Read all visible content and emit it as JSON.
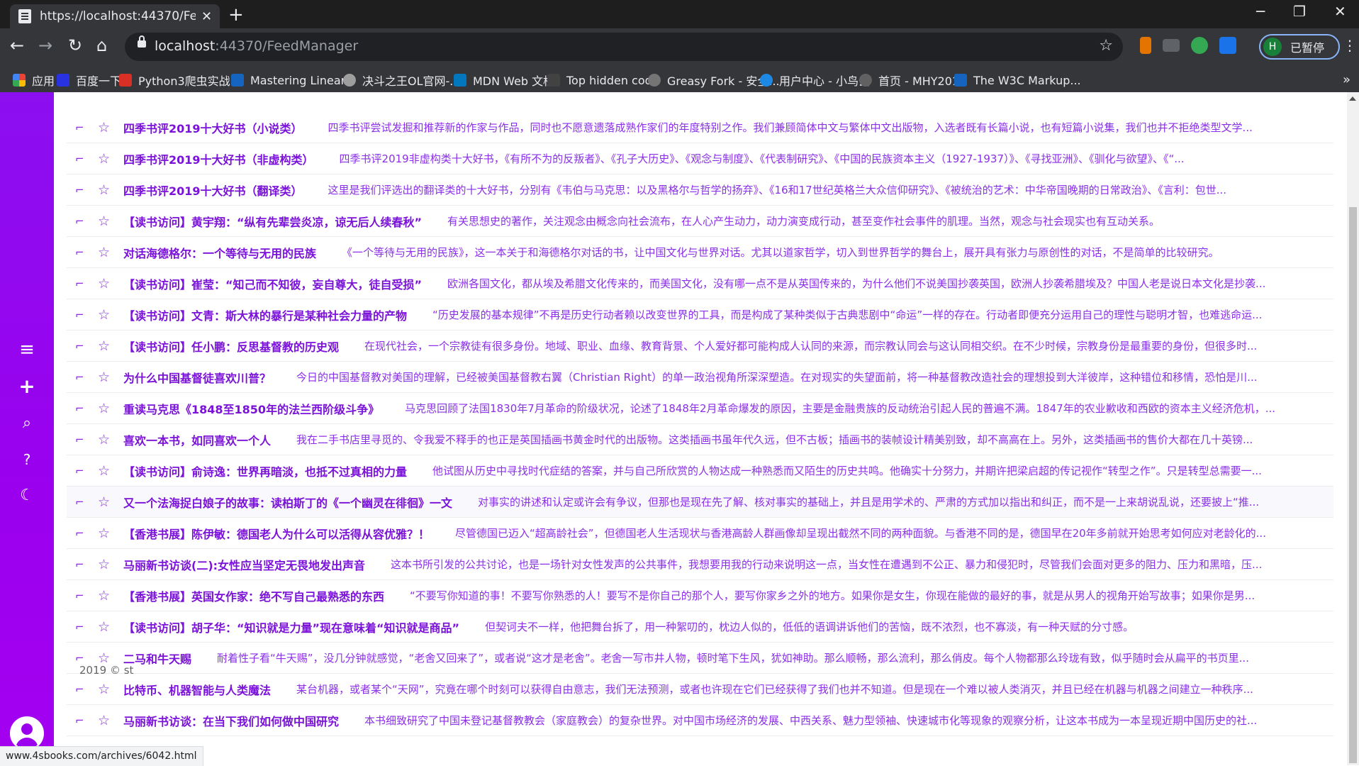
{
  "browser": {
    "tab_title": "https://localhost:44370/FeedM",
    "url_host": "localhost",
    "url_rest": ":44370/FeedManager",
    "profile_initial": "H",
    "profile_label": "已暂停"
  },
  "bookmarks": [
    {
      "label": "应用",
      "color": "#ea4335"
    },
    {
      "label": "百度一下",
      "color": "#2932e1"
    },
    {
      "label": "Python3爬虫实战...",
      "color": "#d93025"
    },
    {
      "label": "Mastering Linear...",
      "color": "#1565c0"
    },
    {
      "label": "决斗之王OL官网-...",
      "color": "#9e9e9e"
    },
    {
      "label": "MDN Web 文档",
      "color": "#0277bd"
    },
    {
      "label": "Top hidden code",
      "color": "#424242"
    },
    {
      "label": "Greasy Fork - 安全...",
      "color": "#757575"
    },
    {
      "label": "用户中心 - 小鸟云",
      "color": "#1e88e5"
    },
    {
      "label": "首页 - MHY2018",
      "color": "#616161"
    },
    {
      "label": "The W3C Markup...",
      "color": "#1565c0"
    }
  ],
  "accent": "#9a00ee",
  "feed": [
    {
      "title": "四季书评2019十大好书（小说类）",
      "desc": "四季书评尝试发掘和推荐新的作家与作品，同时也不愿意遗落成熟作家们的年度特别之作。我们兼顾简体中文与繁体中文出版物，入选者既有长篇小说，也有短篇小说集，我们也并不拒绝类型文学..."
    },
    {
      "title": "四季书评2019十大好书（非虚构类）",
      "desc": "四季书评2019非虚构类十大好书，《有所不为的反叛者》、《孔子大历史》、《观念与制度》、《代表制研究》、《中国的民族资本主义（1927-1937）》、《寻找亚洲》、《驯化与欲望》、《“..."
    },
    {
      "title": "四季书评2019十大好书（翻译类）",
      "desc": "这里是我们评选出的翻译类的十大好书，分别有《韦伯与马克思：以及黑格尔与哲学的扬弃》、《16和17世纪英格兰大众信仰研究》、《被统治的艺术：中华帝国晚期的日常政治》、《言利：包世..."
    },
    {
      "title": "【读书访问】黄宇翔：“纵有先辈尝炎凉，谅无后人续春秋”",
      "desc": "有关思想史的著作，关注观念由概念向社会流布，在人心产生动力，动力演变成行动，甚至变作社会事件的肌理。当然，观念与社会现实也有互动关系。"
    },
    {
      "title": "对话海德格尔：一个等待与无用的民族",
      "desc": "《一个等待与无用的民族》，这一本关于和海德格尔对话的书，让中国文化与世界对话。尤其以道家哲学，切入到世界哲学的舞台上，展开具有张力与原创性的对话，不是简单的比较研究。"
    },
    {
      "title": "【读书访问】崔莹：“知己而不知彼，妄自尊大，徒自受损”",
      "desc": "欧洲各国文化，都从埃及希腊文化传来的，而美国文化，没有哪一点不是从英国传来的，为什么他们不说美国抄袭英国，欧洲人抄袭希腊埃及？中国人老是说日本文化是抄袭..."
    },
    {
      "title": "【读书访问】文青：斯大林的暴行是某种社会力量的产物",
      "desc": "“历史发展的基本规律”不再是历史行动者赖以改变世界的工具，而是构成了某种类似于古典悲剧中“命运”一样的存在。行动者即便充分运用自己的理性与聪明才智，也难逃命运..."
    },
    {
      "title": "【读书访问】任小鹏：反思基督教的历史观",
      "desc": "在现代社会，一个宗教徒有很多身份。地域、职业、血缘、教育背景、个人爱好都可能构成人认同的来源，而宗教认同会与这认同相交织。在不少时候，宗教身份是最重要的身份，但很多时..."
    },
    {
      "title": "为什么中国基督徒喜欢川普？",
      "desc": "今日的中国基督教对美国的理解，已经被美国基督教右翼（Christian Right）的单一政治视角所深深塑造。在对现实的失望面前，将一种基督教改造社会的理想投到大洋彼岸，这种错位和移情，恐怕是川..."
    },
    {
      "title": "重读马克思《1848至1850年的法兰西阶级斗争》",
      "desc": "马克思回顾了法国1830年7月革命的阶级状况，论述了1848年2月革命爆发的原因，主要是金融贵族的反动统治引起人民的普遍不满。1847年的农业歉收和西欧的资本主义经济危机，..."
    },
    {
      "title": "喜欢一本书，如同喜欢一个人",
      "desc": "我在二手书店里寻觅的、令我爱不释手的也正是英国插画书黄金时代的出版物。这类插画书虽年代久远，但不古板；插画书的装帧设计精美别致，却不高高在上。另外，这类插画书的售价大都在几十英镑..."
    },
    {
      "title": "【读书访问】俞诗逸：世界再暗淡，也抵不过真相的力量",
      "desc": "他试图从历史中寻找时代症结的答案，并与自己所欣赏的人物达成一种熟悉而又陌生的历史共鸣。他确实十分努力，并期许把梁启超的传记视作“转型之作”。只是转型总需要一..."
    },
    {
      "title": "又一个法海捉白娘子的故事：读柏斯丁的《一个幽灵在徘徊》一文",
      "desc": "对事实的讲述和认定或许会有争议，但那也是现在先了解、核对事实的基础上，并且是用学术的、严肃的方式加以指出和纠正，而不是一上来胡说乱说，还要披上“推..."
    },
    {
      "title": "【香港书展】陈伊敏：德国老人为什么可以活得从容优雅？！",
      "desc": "尽管德国已迈入“超高龄社会”，但德国老人生活现状与香港高龄人群画像却呈现出截然不同的两种面貌。与香港不同的是，德国早在20年多前就开始思考如何应对老龄化的..."
    },
    {
      "title": "马丽新书访谈(二):女性应当坚定无畏地发出声音",
      "desc": "这本书所引发的公共讨论，也是一场针对女性发声的公共事件，我想要用我的行动来说明这一点，当女性在遭遇到不公正、暴力和侵犯时，尽管我们会面对更多的阻力、压力和黑暗，压..."
    },
    {
      "title": "【香港书展】英国女作家：绝不写自己最熟悉的东西",
      "desc": "“不要写你知道的事！不要写你熟悉的人！要写不是你自己的那个人，要写你家乡之外的地方。如果你是女生，你现在能做的最好的事，就是从男人的视角开始写故事；如果你是男..."
    },
    {
      "title": "【读书访问】胡子华：“知识就是力量”现在意味着“知识就是商品”",
      "desc": "但契诃夫不一样，他把舞台拆了，用一种絮叨的，枕边人似的，低低的语调讲诉他们的苦恼，既不浓烈，也不寡淡，有一种天赋的分寸感。"
    },
    {
      "title": "二马和牛天赐",
      "desc": "耐着性子看“牛天赐”，没几分钟就感觉，“老舍又回来了”，或者说“这才是老舍”。老舍一写市井人物，顿时笔下生风，犹如神助。那么顺畅，那么流利，那么俏皮。每个人物都那么玲珑有致，似乎随时会从扁平的书页里..."
    },
    {
      "title": "比特币、机器智能与人类魔法",
      "desc": "某台机器，或者某个“天网”，究竟在哪个时刻可以获得自由意志，我们无法预测，或者也许现在它们已经获得了我们也并不知道。但是现在一个难以被人类消灭，并且已经在机器与机器之间建立一种秩序..."
    },
    {
      "title": "马丽新书访谈：在当下我们如何做中国研究",
      "desc": "本书细致研究了中国未登记基督教教会（家庭教会）的复杂世界。对中国市场经济的发展、中西关系、魅力型领袖、快速城市化等现象的观察分析，让这本书成为一本呈现近期中国历史的社..."
    }
  ],
  "copyright": "2019 © st",
  "status_url": "www.4sbooks.com/archives/6042.html"
}
